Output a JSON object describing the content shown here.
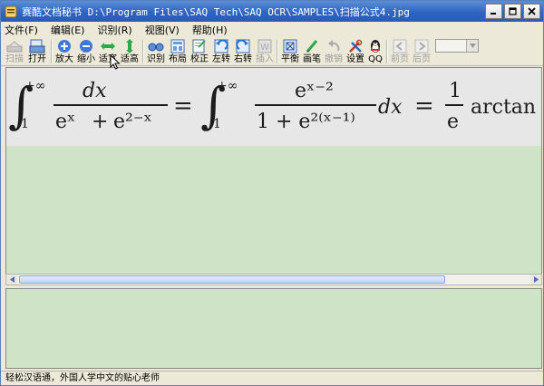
{
  "window": {
    "title": "赛酷文档秘书 D:\\Program Files\\SAQ Tech\\SAQ OCR\\SAMPLES\\扫描公式4.jpg",
    "controls": [
      "minimize",
      "maximize",
      "close"
    ]
  },
  "menu": {
    "items": [
      {
        "label": "文件(F)"
      },
      {
        "label": "编辑(E)"
      },
      {
        "label": "识别(R)"
      },
      {
        "label": "视图(V)"
      },
      {
        "label": "帮助(H)"
      }
    ]
  },
  "toolbar": {
    "scan": "扫描",
    "open": "打开",
    "zoom_in": "放大",
    "zoom_out": "缩小",
    "fit_width": "适宽",
    "fit_height": "适高",
    "recognize": "识别",
    "layout": "布局",
    "correct": "校正",
    "rotate_left": "左转",
    "rotate_right": "右转",
    "insert": "插入",
    "balance": "平衡",
    "brush": "画笔",
    "undo": "撤销",
    "settings": "设置",
    "qq": "QQ",
    "prev_page": "前页",
    "next_page": "后页",
    "page_select_value": ""
  },
  "formula": {
    "integral1_upper": "+∞",
    "integral1_lower": "1",
    "numerator1": "dx",
    "denominator1_a": "eˣ",
    "plus": "+",
    "denominator1_b": "e²⁻ˣ",
    "equals": "=",
    "integral2_upper": "+∞",
    "integral2_lower": "1",
    "numerator2": "eˣ⁻²",
    "denominator2": "1 + e²⁽ˣ⁻¹⁾",
    "dx": "dx",
    "frac_num": "1",
    "frac_den": "e",
    "arctan": "arctan"
  },
  "status": {
    "text": "轻松汉语通，外国人学中文的贴心老师"
  },
  "colors": {
    "title_bar": "#2f64c4",
    "pane_background": "#cfe4c6",
    "chrome": "#ece9d8"
  }
}
